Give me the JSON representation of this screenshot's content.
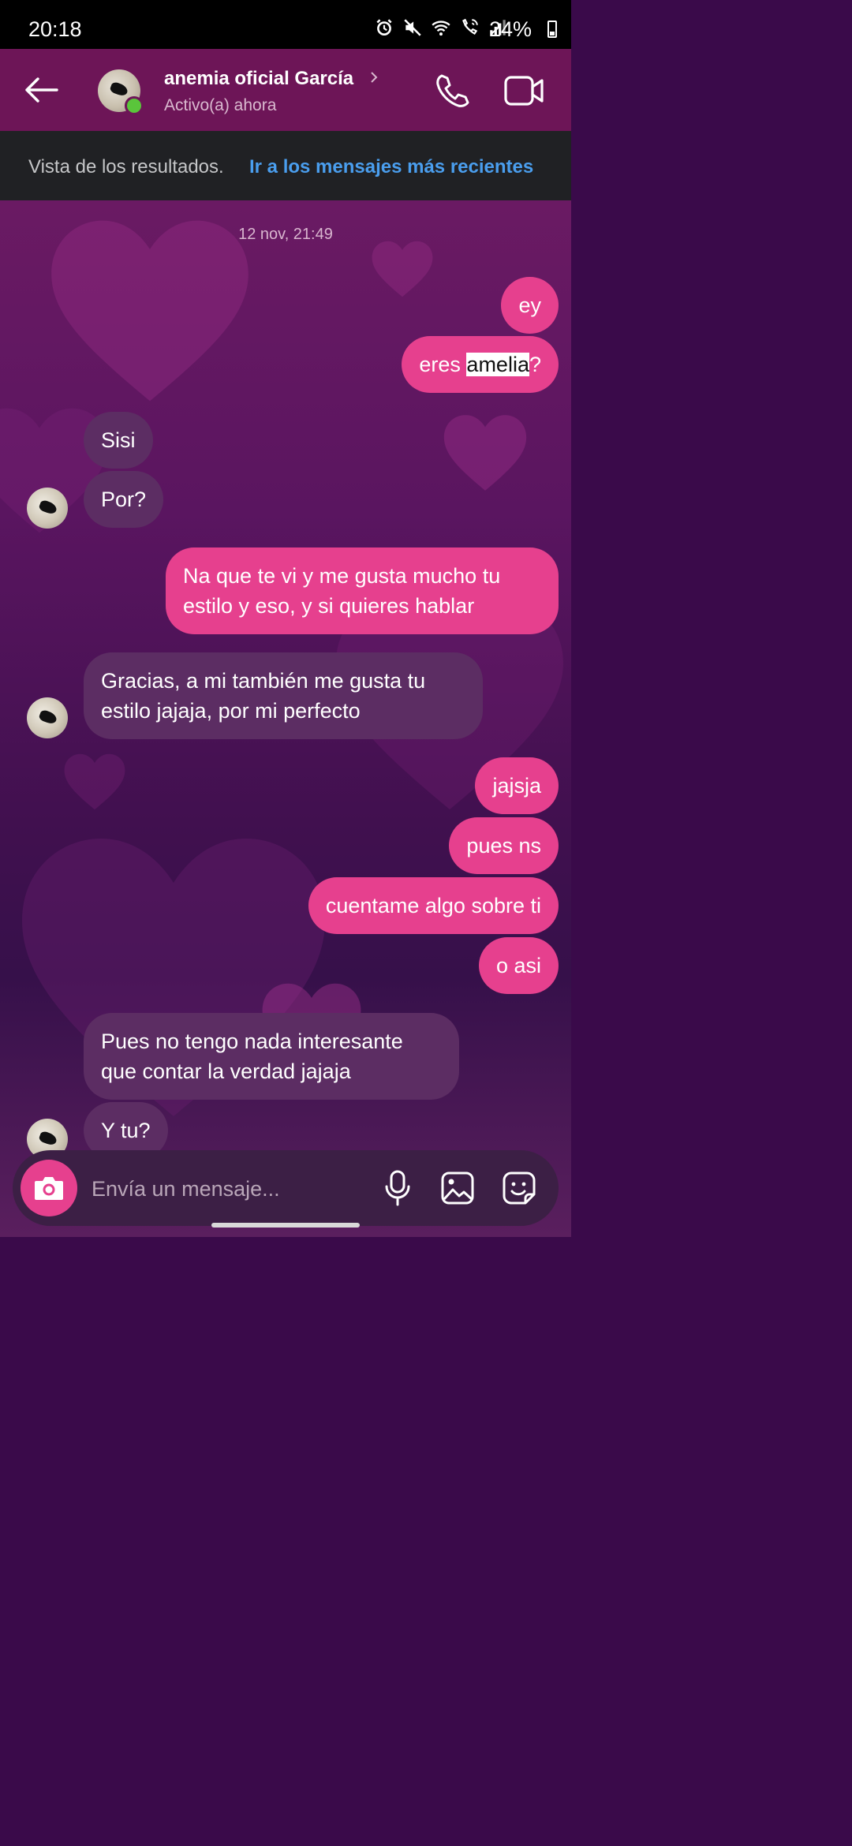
{
  "status_bar": {
    "time": "20:18",
    "battery": "24%"
  },
  "header": {
    "contact_name": "anemia oficial García",
    "contact_status": "Activo(a) ahora"
  },
  "banner": {
    "text": "Vista de los resultados.",
    "link": "Ir a los mensajes más recientes"
  },
  "chat": {
    "date": "12 nov, 21:49",
    "messages": [
      {
        "text": "ey"
      },
      {
        "before": "eres ",
        "highlight": "amelia",
        "after": "?"
      },
      {
        "text": "Sisi"
      },
      {
        "text": "Por?"
      },
      {
        "text": "Na que te vi y me gusta mucho tu estilo y eso, y si quieres hablar"
      },
      {
        "text": "Gracias, a mi también me gusta tu estilo jajaja, por mi perfecto"
      },
      {
        "text": "jajsja"
      },
      {
        "text": "pues ns"
      },
      {
        "text": "cuentame algo sobre ti"
      },
      {
        "text": "o asi"
      },
      {
        "text": "Pues no tengo nada interesante que contar la verdad jajaja"
      },
      {
        "text": "Y tu?"
      }
    ]
  },
  "composer": {
    "placeholder": "Envía un mensaje..."
  },
  "colors": {
    "header_bg": "#6d1557",
    "outgoing_bubble": "#e6408e",
    "incoming_bubble": "#5c2d63",
    "banner_bg": "#202124",
    "link": "#4a9eee",
    "online": "#5ac53b"
  },
  "icons": [
    "back-arrow-icon",
    "phone-icon",
    "video-camera-icon",
    "camera-icon",
    "microphone-icon",
    "gallery-icon",
    "sticker-icon"
  ]
}
